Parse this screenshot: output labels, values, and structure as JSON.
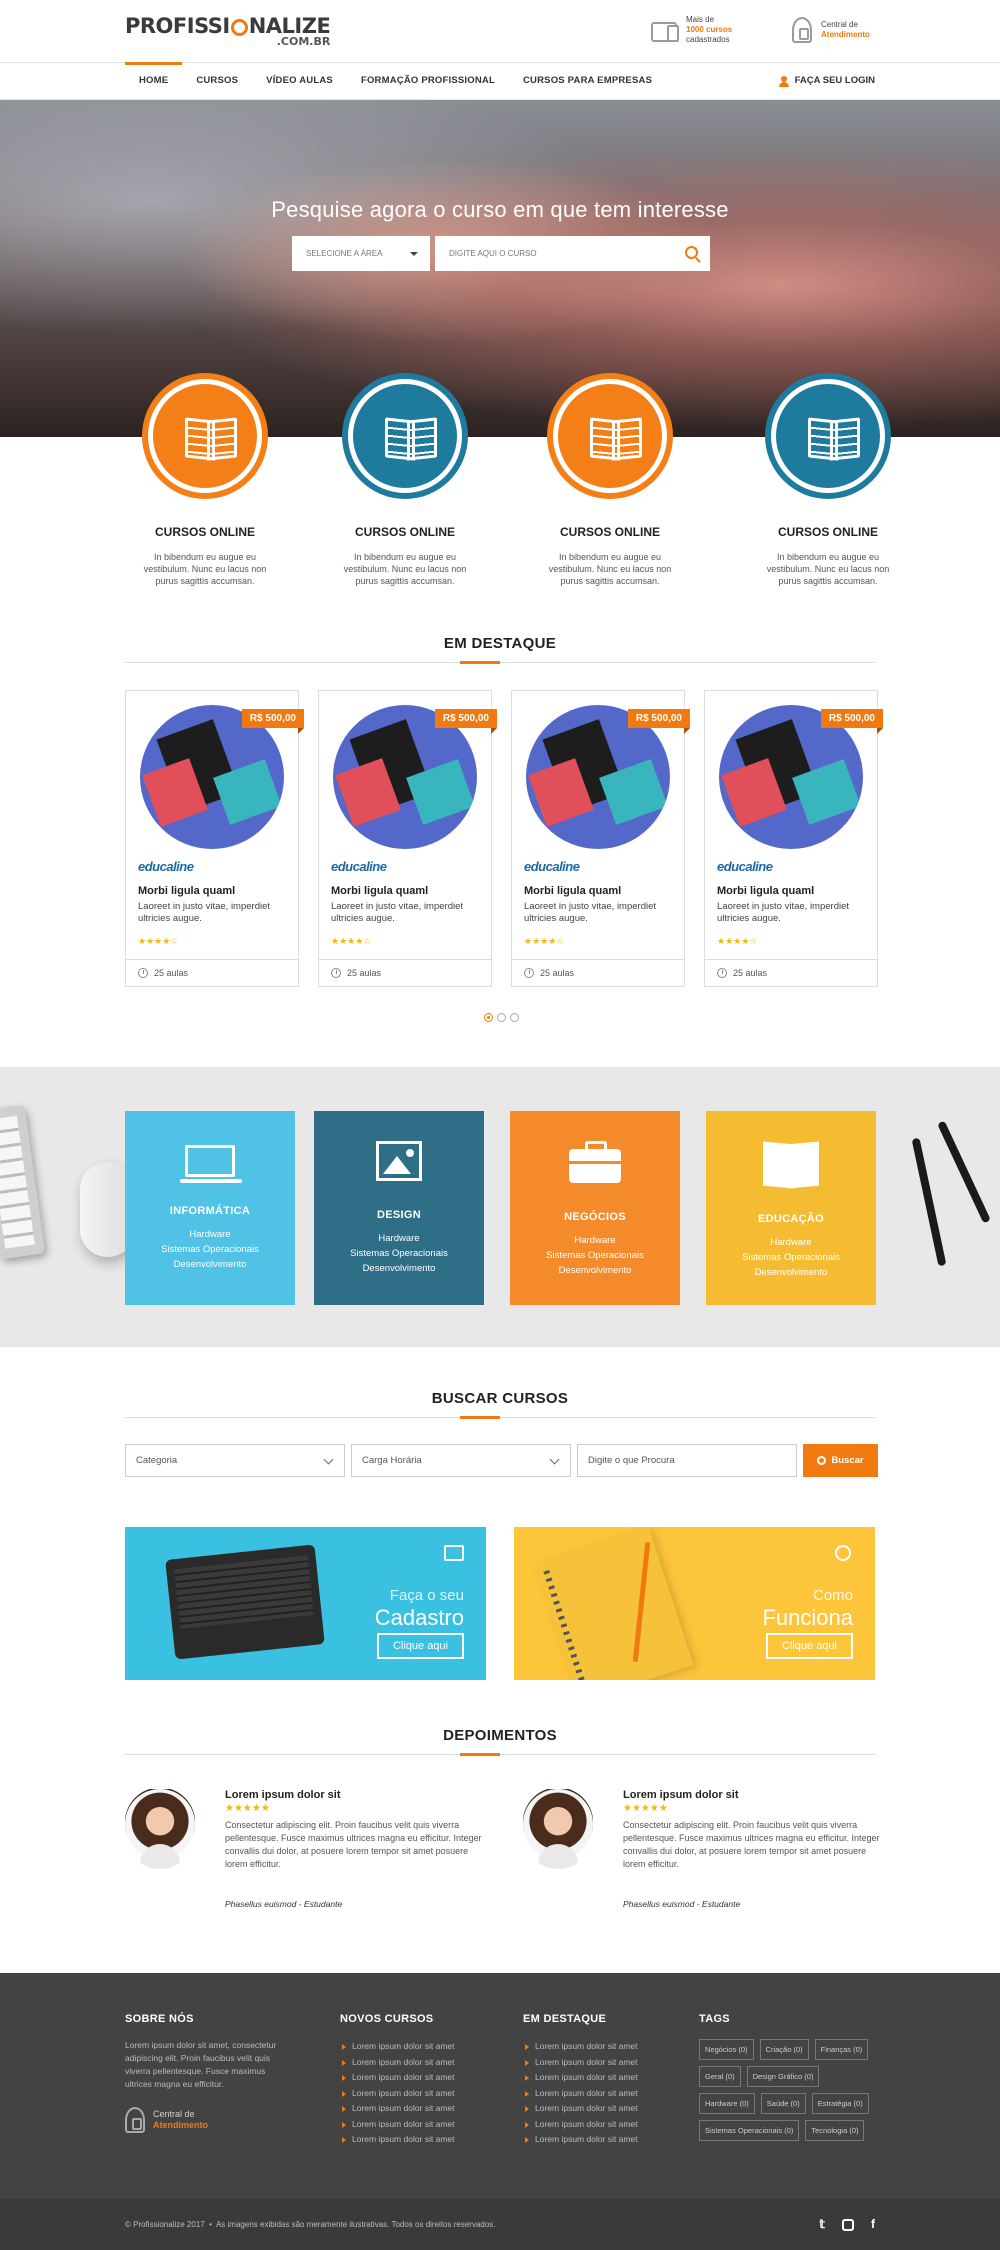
{
  "header": {
    "logo_main_pre": "PROFISSI",
    "logo_main_post": "NALIZE",
    "logo_sub": ".COM.BR",
    "courses_info": {
      "line1": "Mais de",
      "line2": "1000 cursos",
      "line3": "cadastrados"
    },
    "support_info": {
      "line1": "Central de",
      "line2": "Atendimento"
    }
  },
  "nav": {
    "items": [
      "HOME",
      "CURSOS",
      "VÍDEO AULAS",
      "FORMAÇÃO PROFISSIONAL",
      "CURSOS PARA EMPRESAS"
    ],
    "active": "HOME",
    "login": "FAÇA SEU LOGIN"
  },
  "hero": {
    "title": "Pesquise agora o curso em que tem interesse",
    "area_select": "SELECIONE A ÁREA",
    "course_placeholder": "DIGITE AQUI O CURSO"
  },
  "features": [
    {
      "title": "CURSOS ONLINE",
      "text": "In bibendum eu augue eu vestibulum. Nunc eu lacus non purus sagittis accumsan.",
      "color": "orange"
    },
    {
      "title": "CURSOS ONLINE",
      "text": "In bibendum eu augue eu vestibulum. Nunc eu lacus non purus sagittis accumsan.",
      "color": "blue"
    },
    {
      "title": "CURSOS ONLINE",
      "text": "In bibendum eu augue eu vestibulum. Nunc eu lacus non purus sagittis accumsan.",
      "color": "orange"
    },
    {
      "title": "CURSOS ONLINE",
      "text": "In bibendum eu augue eu vestibulum. Nunc eu lacus non purus sagittis accumsan.",
      "color": "blue"
    }
  ],
  "destaque": {
    "title": "EM DESTAQUE",
    "cards": [
      {
        "price": "R$ 500,00",
        "brand": "educaline",
        "name": "Morbi ligula quaml",
        "desc": "Laoreet in justo vitae, imperdiet ultricies augue.",
        "rating": 4,
        "lessons": "25 aulas"
      },
      {
        "price": "R$ 500,00",
        "brand": "educaline",
        "name": "Morbi ligula quaml",
        "desc": "Laoreet in justo vitae, imperdiet ultricies augue.",
        "rating": 4,
        "lessons": "25 aulas"
      },
      {
        "price": "R$ 500,00",
        "brand": "educaline",
        "name": "Morbi ligula quaml",
        "desc": "Laoreet in justo vitae, imperdiet ultricies augue.",
        "rating": 4,
        "lessons": "25 aulas"
      },
      {
        "price": "R$ 500,00",
        "brand": "educaline",
        "name": "Morbi ligula quaml",
        "desc": "Laoreet in justo vitae, imperdiet ultricies augue.",
        "rating": 4,
        "lessons": "25 aulas"
      }
    ],
    "pages": 3,
    "current_page": 1
  },
  "categories": [
    {
      "title": "INFORMÁTICA",
      "items": [
        "Hardware",
        "Sistemas Operacionais",
        "Desenvolvimento"
      ],
      "color": "#4fc2e6",
      "icon": "monitor-icon"
    },
    {
      "title": "DESIGN",
      "items": [
        "Hardware",
        "Sistemas Operacionais",
        "Desenvolvimento"
      ],
      "color": "#2e6e86",
      "icon": "image-icon"
    },
    {
      "title": "NEGÓCIOS",
      "items": [
        "Hardware",
        "Sistemas Operacionais",
        "Desenvolvimento"
      ],
      "color": "#f58a2a",
      "icon": "briefcase-icon"
    },
    {
      "title": "EDUCAÇÃO",
      "items": [
        "Hardware",
        "Sistemas Operacionais",
        "Desenvolvimento"
      ],
      "color": "#f6bc31",
      "icon": "book-icon"
    }
  ],
  "buscar": {
    "title": "BUSCAR CURSOS",
    "categoria": "Categoria",
    "carga": "Carga Horária",
    "placeholder": "Digite o que Procura",
    "button": "Buscar"
  },
  "banners": [
    {
      "small": "Faça o seu",
      "large": "Cadastro",
      "button": "Clique aqui"
    },
    {
      "small": "Como",
      "large": "Funciona",
      "button": "Clique aqui"
    }
  ],
  "depoimentos": {
    "title": "DEPOIMENTOS",
    "items": [
      {
        "name": "Lorem ipsum dolor sit",
        "rating": 5,
        "text": "Consectetur adipiscing elit. Proin faucibus velit quis viverra pellentesque. Fusce maximus ultrices magna eu efficitur. Integer convallis dui dolor, at posuere lorem tempor sit amet posuere lorem efficitur.",
        "author": "Phasellus euismod - Estudante"
      },
      {
        "name": "Lorem ipsum dolor sit",
        "rating": 5,
        "text": "Consectetur adipiscing elit. Proin faucibus velit quis viverra pellentesque. Fusce maximus ultrices magna eu efficitur. Integer convallis dui dolor, at posuere lorem tempor sit amet posuere lorem efficitur.",
        "author": "Phasellus euismod - Estudante"
      }
    ]
  },
  "footer": {
    "sobre": {
      "title": "SOBRE NÓS",
      "text": "Lorem ipsum dolor sit amet, consectetur adipiscing elit. Proin faucibus velit quis viverra pellentesque. Fusce maximus ultrices magna eu efficitur.",
      "support1": "Central de",
      "support2": "Atendimento"
    },
    "novos": {
      "title": "NOVOS CURSOS",
      "items": [
        "Lorem ipsum dolor sit amet",
        "Lorem ipsum dolor sit amet",
        "Lorem ipsum dolor sit amet",
        "Lorem ipsum dolor sit amet",
        "Lorem ipsum dolor sit amet",
        "Lorem ipsum dolor sit amet",
        "Lorem ipsum dolor sit amet"
      ]
    },
    "destaque": {
      "title": "EM DESTAQUE",
      "items": [
        "Lorem ipsum dolor sit amet",
        "Lorem ipsum dolor sit amet",
        "Lorem ipsum dolor sit amet",
        "Lorem ipsum dolor sit amet",
        "Lorem ipsum dolor sit amet",
        "Lorem ipsum dolor sit amet",
        "Lorem ipsum dolor sit amet"
      ]
    },
    "tags": {
      "title": "TAGS",
      "items": [
        "Negócios (0)",
        "Criação (0)",
        "Finanças (0)",
        "Geral (0)",
        "Design Gráfico (0)",
        "Hardware (0)",
        "Saúde (0)",
        "Estratégia (0)",
        "Sistemas Operacionais (0)",
        "Tecnologia (0)"
      ]
    },
    "copyright": "© Profissionalize 2017",
    "disclaimer": "As imagens exibidas são meramente ilustrativas. Todos os direitos reservados.",
    "social": [
      "twitter-icon",
      "instagram-icon",
      "facebook-icon"
    ]
  }
}
